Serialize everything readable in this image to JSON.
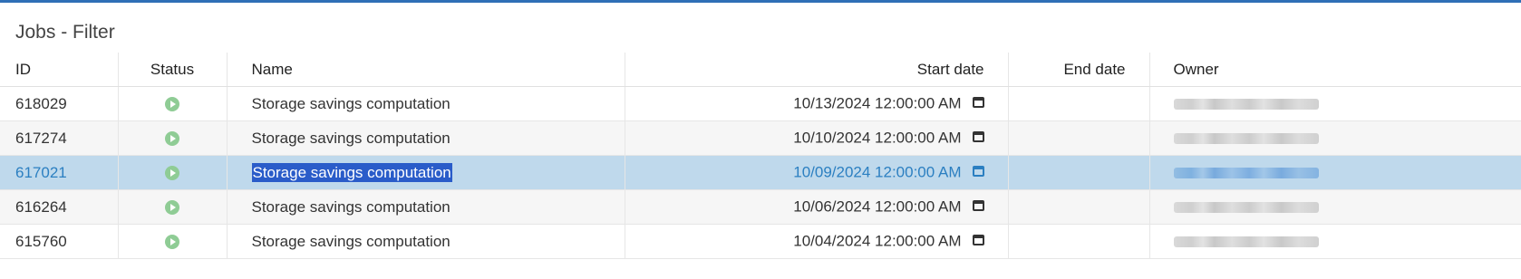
{
  "panel": {
    "title": "Jobs - Filter"
  },
  "columns": {
    "id": "ID",
    "status": "Status",
    "name": "Name",
    "start_date": "Start date",
    "end_date": "End date",
    "owner": "Owner"
  },
  "rows": [
    {
      "id": "618029",
      "status": "running",
      "name": "Storage savings computation",
      "start_date": "10/13/2024 12:00:00 AM",
      "end_date": ""
    },
    {
      "id": "617274",
      "status": "running",
      "name": "Storage savings computation",
      "start_date": "10/10/2024 12:00:00 AM",
      "end_date": ""
    },
    {
      "id": "617021",
      "status": "running",
      "name": "Storage savings computation",
      "start_date": "10/09/2024 12:00:00 AM",
      "end_date": "",
      "selected": true
    },
    {
      "id": "616264",
      "status": "running",
      "name": "Storage savings computation",
      "start_date": "10/06/2024 12:00:00 AM",
      "end_date": ""
    },
    {
      "id": "615760",
      "status": "running",
      "name": "Storage savings computation",
      "start_date": "10/04/2024 12:00:00 AM",
      "end_date": ""
    }
  ],
  "icons": {
    "status": "play-circle-icon",
    "date": "calendar-icon"
  },
  "colors": {
    "accent": "#2f6fb6",
    "selected_row_bg": "#bfd9ec",
    "selected_text": "#2b7fc1",
    "status_green": "#8fcc95",
    "text_highlight": "#2a5cc9"
  }
}
